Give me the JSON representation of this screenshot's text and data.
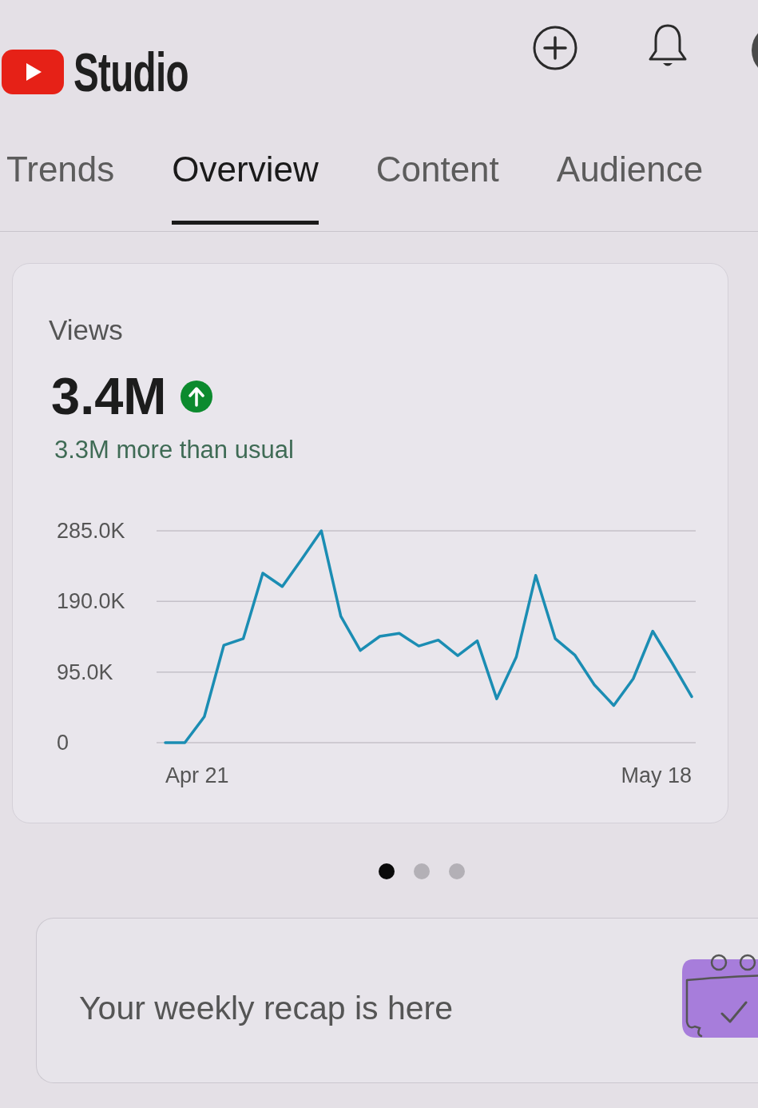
{
  "header": {
    "logo_text": "Studio"
  },
  "tabs": [
    {
      "label": "Trends",
      "selected": false
    },
    {
      "label": "Overview",
      "selected": true
    },
    {
      "label": "Content",
      "selected": false
    },
    {
      "label": "Audience",
      "selected": false
    }
  ],
  "views_card": {
    "title": "Views",
    "value": "3.4M",
    "rising": true,
    "comparison": "3.3M more than usual",
    "x_axis_labels": [
      "Apr 21",
      "May 18"
    ],
    "chart_data": {
      "type": "line",
      "ylim": [
        0,
        285000
      ],
      "yticks": [
        0,
        {
          "value": 95000,
          "label": "95.0K"
        },
        {
          "value": 190000,
          "label": "190.0K"
        },
        {
          "value": 285000,
          "label": "285.0K"
        }
      ],
      "series": [
        {
          "color": "#1b8db3",
          "values": [
            0,
            0,
            35000,
            131000,
            140000,
            228000,
            210000,
            247000,
            285000,
            170000,
            124000,
            143000,
            147000,
            130000,
            138000,
            117000,
            137000,
            59000,
            115000,
            225000,
            140000,
            118000,
            78000,
            50000,
            86000,
            150000,
            107000,
            62000
          ]
        }
      ]
    }
  },
  "pager": {
    "dots": [
      {
        "selected": true
      },
      {
        "selected": false
      },
      {
        "selected": false
      }
    ]
  },
  "recap_card": {
    "text": "Your weekly recap is here"
  }
}
